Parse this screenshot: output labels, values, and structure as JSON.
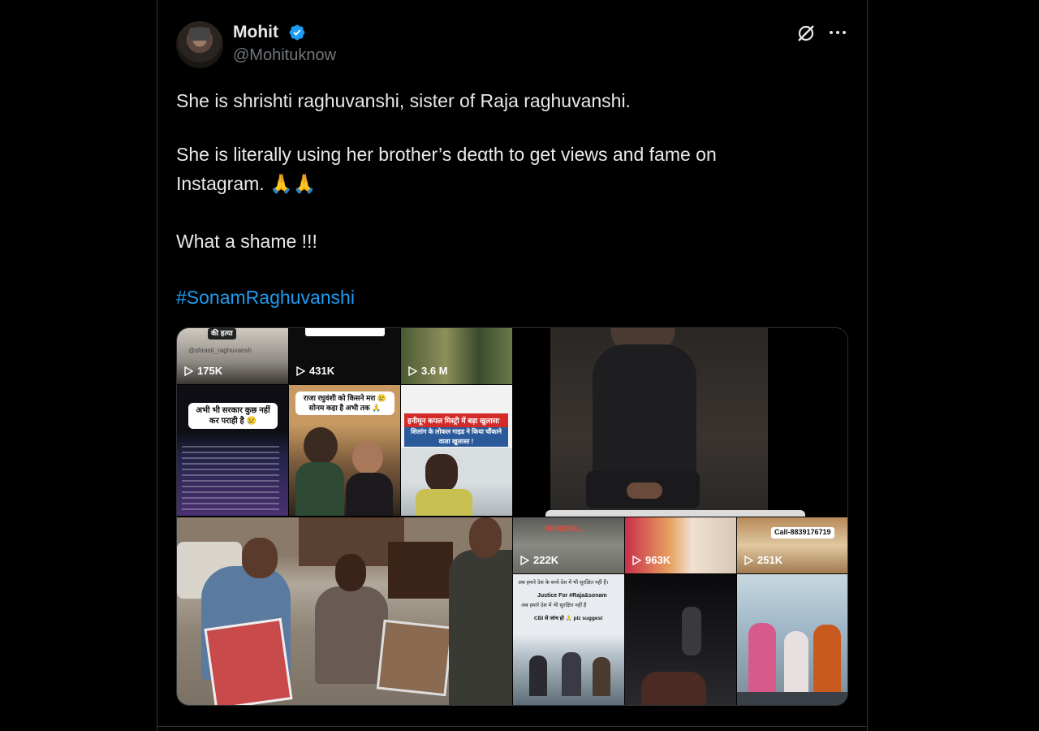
{
  "author": {
    "name": "Mohit",
    "handle": "@Mohituknow"
  },
  "icons": [
    "verified-badge-icon",
    "grok-icon",
    "more-icon",
    "play-icon"
  ],
  "colors": {
    "accent": "#1d9bf0",
    "text": "#e7e9ea",
    "muted": "#71767b",
    "background": "#000000"
  },
  "post": {
    "line1": "She is shrishti raghuvanshi, sister of Raja raghuvanshi.",
    "line2": "She is literally using her brother’s deαth to get views and fame on",
    "line3": "Instagram. 🙏🙏",
    "line4": "What a shame !!!",
    "hashtag": "#SonamRaghuvanshi"
  },
  "media": {
    "top_left_grid": {
      "views": [
        "175K",
        "431K",
        "3.6 M"
      ],
      "captions": {
        "tile1_top": "की हत्या",
        "tile1_user": "@shrasti_raghuvansh",
        "tile4": "अभी भी सरकार कुछ नहीं कर पराही है 😢",
        "tile5": "राजा रघुवंशी को किसने मरा 😢 सोनम कहा है अभी तक 🙏",
        "tile6_red": "हनीमून कपल मिस्ट्री में बड़ा खुलासा",
        "tile6_blue": "शिलांग के लोकल गाइड ने किया चौंकाने वाला खुलासा !"
      }
    },
    "bottom_right_grid": {
      "views": [
        "222K",
        "963K",
        "251K"
      ],
      "captions": {
        "tile1_number": "9039299...",
        "tile3_call": "Call-8839176719",
        "tile4_line1": "अब हमारे देश के बच्चे देश में भी सुरक्षित नहीं हैं।",
        "tile4_justice": "Justice For #Raja&sonam",
        "tile4_line2": "अब हमारे देश में भी सुरक्षित नहीं हैं",
        "tile4_cbi": "CBI से जांच हो 🙏 plz suggest"
      }
    }
  }
}
